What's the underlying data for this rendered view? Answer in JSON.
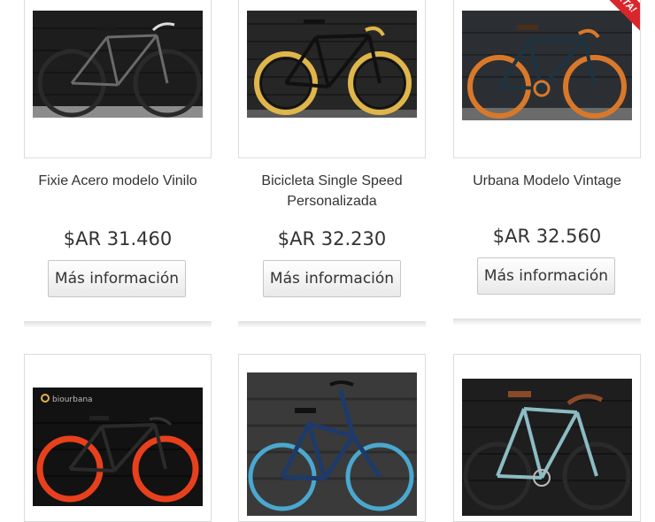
{
  "products": [
    {
      "title": "Fixie Acero modelo Vinilo",
      "price": "$AR 31.460",
      "button": "Más información"
    },
    {
      "title": "Bicicleta Single Speed Personalizada",
      "price": "$AR 32.230",
      "button": "Más información"
    },
    {
      "title": "Urbana Modelo Vintage",
      "price": "$AR 32.560",
      "button": "Más información",
      "ribbon": "XTA!"
    },
    {
      "photo_logo": "biourbana"
    },
    {},
    {}
  ],
  "colors": {
    "wheel_gray": "#2a2a2a",
    "wheel_gold": "#e0b64a",
    "wheel_orange": "#d8782a",
    "wheel_red": "#e8401c",
    "wheel_blue": "#4aa8d0",
    "ribbon": "#d9262c"
  }
}
